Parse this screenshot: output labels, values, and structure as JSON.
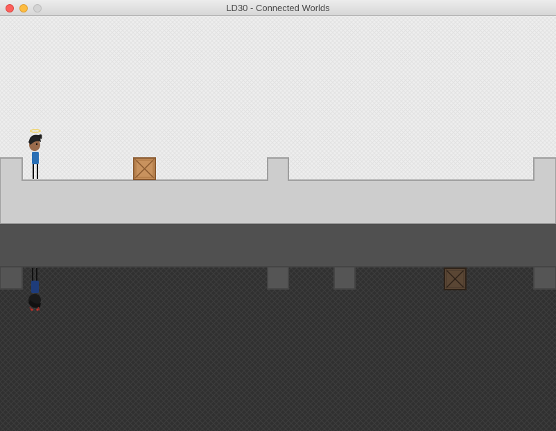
{
  "window": {
    "title": "LD30 - Connected Worlds"
  },
  "colors": {
    "light_sky": "#eeeeee",
    "light_ground": "#cdcdcd",
    "ground_edge": "#9e9e9e",
    "band": "#505050",
    "dark_ground": "#555555",
    "dark_bg": "#2f2f2f",
    "crate_light": "#c8925e",
    "crate_dark": "#5a4634"
  },
  "scene": {
    "upper_world": {
      "character": "angel-player",
      "objects": [
        "wooden-crate"
      ]
    },
    "lower_world": {
      "character": "shadow-player",
      "objects": [
        "dark-crate"
      ]
    }
  }
}
